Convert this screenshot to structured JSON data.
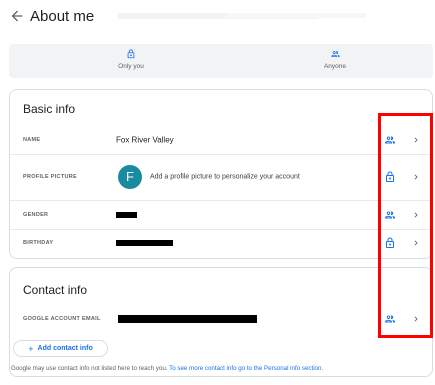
{
  "header": {
    "title": "About me"
  },
  "visibility": {
    "only_you": "Only you",
    "anyone": "Anyone"
  },
  "basic_info": {
    "title": "Basic info",
    "rows": {
      "name": {
        "label": "NAME",
        "value": "Fox River Valley",
        "visibility_icon": "people-icon"
      },
      "profile_picture": {
        "label": "PROFILE PICTURE",
        "avatar_letter": "F",
        "text": "Add a profile picture to personalize your account",
        "visibility_icon": "lock-icon"
      },
      "gender": {
        "label": "GENDER",
        "visibility_icon": "people-icon"
      },
      "birthday": {
        "label": "BIRTHDAY",
        "visibility_icon": "lock-icon"
      }
    }
  },
  "contact_info": {
    "title": "Contact info",
    "rows": {
      "email": {
        "label": "GOOGLE ACCOUNT EMAIL",
        "visibility_icon": "people-icon"
      }
    },
    "add_button": "Add contact info",
    "add_icon": "+"
  },
  "footer": {
    "note": "Google may use contact info not listed here to reach you. ",
    "note_link": "To see more contact info go to the Personal info section."
  },
  "colors": {
    "accent": "#1a73e8",
    "highlight": "#ff0000",
    "avatar": "#1a8aa0"
  }
}
